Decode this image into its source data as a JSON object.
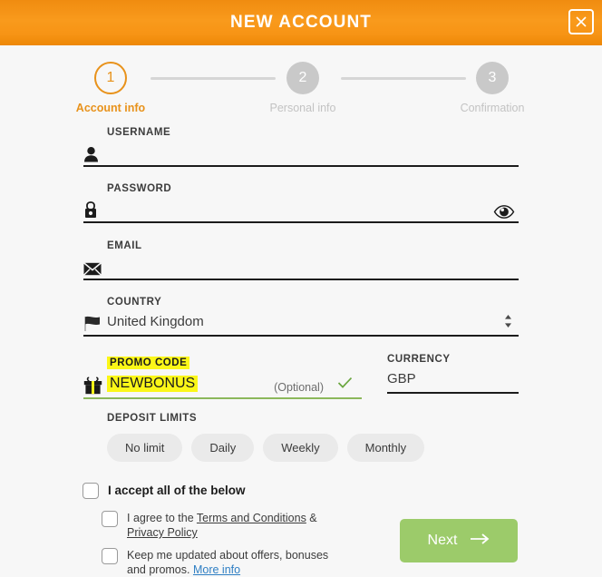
{
  "header": {
    "title": "NEW ACCOUNT",
    "close_icon": "close-icon"
  },
  "stepper": {
    "steps": [
      {
        "number": "1",
        "label": "Account info",
        "state": "active"
      },
      {
        "number": "2",
        "label": "Personal info",
        "state": "inactive"
      },
      {
        "number": "3",
        "label": "Confirmation",
        "state": "inactive"
      }
    ]
  },
  "form": {
    "username": {
      "label": "USERNAME",
      "value": "",
      "placeholder": "",
      "icon": "user-icon"
    },
    "password": {
      "label": "PASSWORD",
      "value": "",
      "placeholder": "",
      "icon": "lock-icon",
      "toggle_icon": "eye-icon"
    },
    "email": {
      "label": "EMAIL",
      "value": "",
      "placeholder": "",
      "icon": "envelope-icon"
    },
    "country": {
      "label": "COUNTRY",
      "value": "United Kingdom",
      "icon": "flag-icon",
      "caret_icon": "chevron-updown-icon"
    },
    "promo_code": {
      "label": "PROMO CODE",
      "value": "NEWBONUS",
      "optional_text": "(Optional)",
      "icon": "gift-icon",
      "valid_icon": "check-icon",
      "highlight_color": "#fbf718",
      "underline_color": "#8cb85b"
    },
    "currency": {
      "label": "CURRENCY",
      "value": "GBP"
    },
    "deposit_limits": {
      "label": "DEPOSIT LIMITS",
      "options": [
        "No limit",
        "Daily",
        "Weekly",
        "Monthly"
      ]
    },
    "consents": {
      "accept_all": {
        "label": "I accept all of the below",
        "checked": false
      },
      "terms": {
        "prefix": "I agree to the ",
        "link1": "Terms and Conditions",
        "joiner": " &",
        "link2": "Privacy Policy",
        "checked": false
      },
      "marketing": {
        "line1": "Keep me updated about offers, bonuses",
        "line2": "and promos. ",
        "link": "More info",
        "checked": false
      }
    },
    "next_button": {
      "label": "Next",
      "icon": "arrow-right-icon"
    }
  },
  "colors": {
    "header_orange": "#f79415",
    "accent_orange": "#e8921b",
    "next_green": "#9ccb6a",
    "promo_yellow": "#fbf718",
    "link_blue": "#2f7fc4",
    "page_bg": "#f7f7f7"
  }
}
